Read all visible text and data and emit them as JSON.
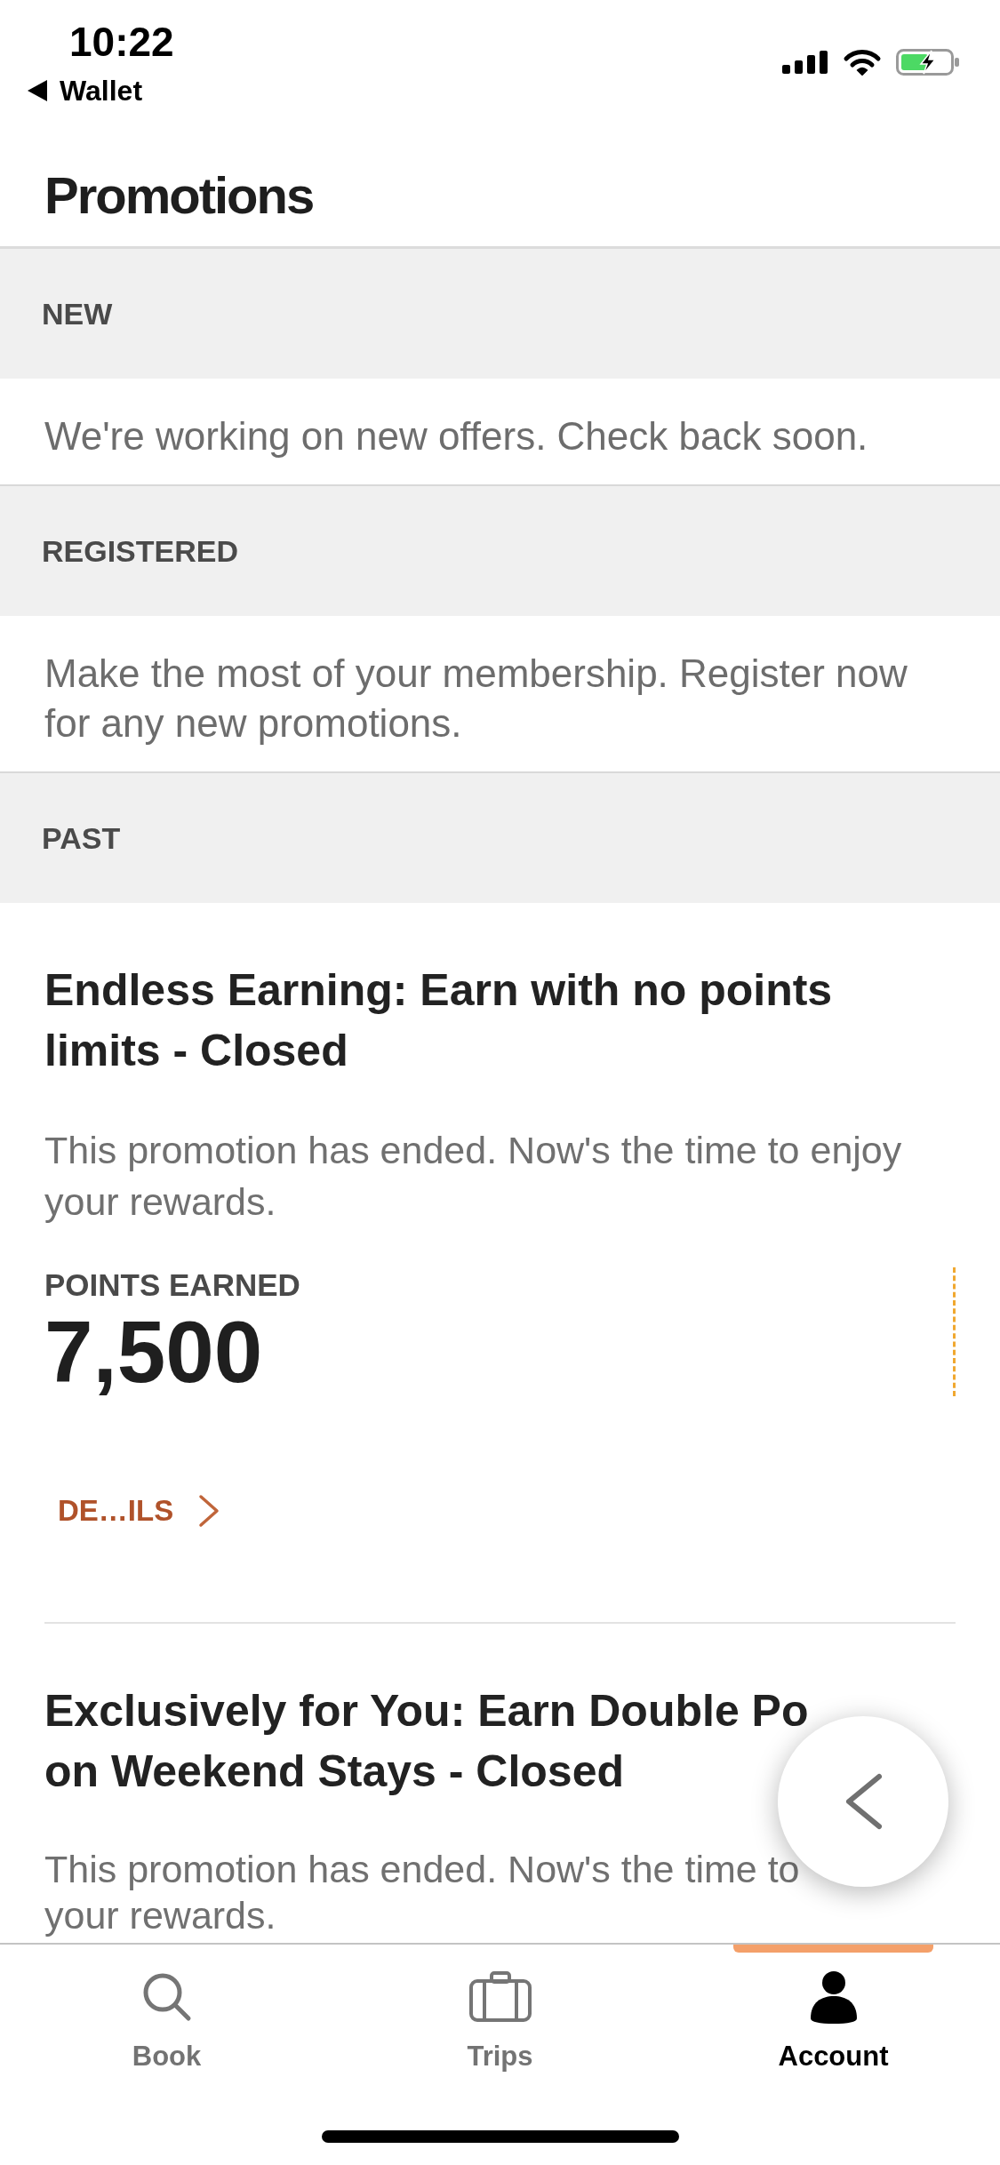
{
  "status_bar": {
    "time": "10:22",
    "back_label": "Wallet"
  },
  "title": "Promotions",
  "sections": [
    {
      "heading": "NEW",
      "message": "We're working on new offers. Check back soon."
    },
    {
      "heading": "REGISTERED",
      "message": "Make the most of your membership. Register now for any new promotions."
    },
    {
      "heading": "PAST",
      "promotions": [
        {
          "title": "Endless Earning: Earn with no points limits - Closed",
          "description": "This promotion has ended. Now's the time to enjoy your rewards.",
          "points_label": "POINTS EARNED",
          "points": "7,500",
          "details_label": "DE…ILS"
        },
        {
          "title_lines": [
            "Exclusively for You: Earn Double Po",
            "on Weekend Stays - Closed"
          ],
          "description_lines": [
            "This promotion has ended. Now's the time to",
            "your rewards."
          ]
        }
      ]
    }
  ],
  "tabs": [
    {
      "label": "Book",
      "kind": "search",
      "selected": false
    },
    {
      "label": "Trips",
      "kind": "suitcase",
      "selected": false
    },
    {
      "label": "Account",
      "kind": "person",
      "selected": true
    }
  ]
}
